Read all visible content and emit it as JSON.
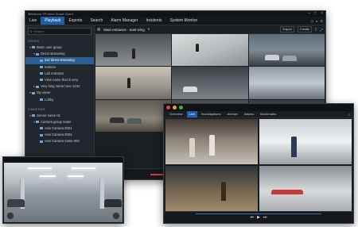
{
  "main_window": {
    "title": "Milestone XProtect Smart Client",
    "menu": [
      "Live",
      "Playback",
      "Exports",
      "Search",
      "Alarm Manager",
      "Incidents",
      "System Monitor"
    ],
    "active_menu": "Playback",
    "search_placeholder": "Search",
    "views_header": "VIEWS",
    "view_items": [
      {
        "label": "Basic user group",
        "selected": false
      },
      {
        "label": "Direct streaming",
        "selected": false
      },
      {
        "label": "2x2 direct streaming",
        "selected": true
      },
      {
        "label": "Indoors",
        "selected": false
      },
      {
        "label": "Lab entrance",
        "selected": false
      },
      {
        "label": "View name that is very",
        "selected": false
      },
      {
        "label": "Very long name here 1234",
        "selected": false
      },
      {
        "label": "My views",
        "selected": false
      },
      {
        "label": "Lobby",
        "selected": false
      }
    ],
    "cameras_header": "CAMERAS",
    "camera_items": [
      {
        "label": "Server name 01",
        "selected": false
      },
      {
        "label": "Camera group name",
        "selected": false
      },
      {
        "label": "Axis Camera 0001",
        "selected": false
      },
      {
        "label": "Axis Camera 0002",
        "selected": false
      },
      {
        "label": "Axis Camera name 004",
        "selected": false
      }
    ],
    "current_view": "Main entrance - east wing",
    "export_label": "Export",
    "create_label": "Create"
  },
  "second_window": {
    "tabs": [
      "Overview",
      "Live",
      "Investigations",
      "Archive",
      "Alarms",
      "Bookmarks"
    ],
    "active_tab": "Live"
  },
  "colors": {
    "accent": "#1f5fa8",
    "window_bg": "#1d2126",
    "alert": "#d23a3a"
  }
}
